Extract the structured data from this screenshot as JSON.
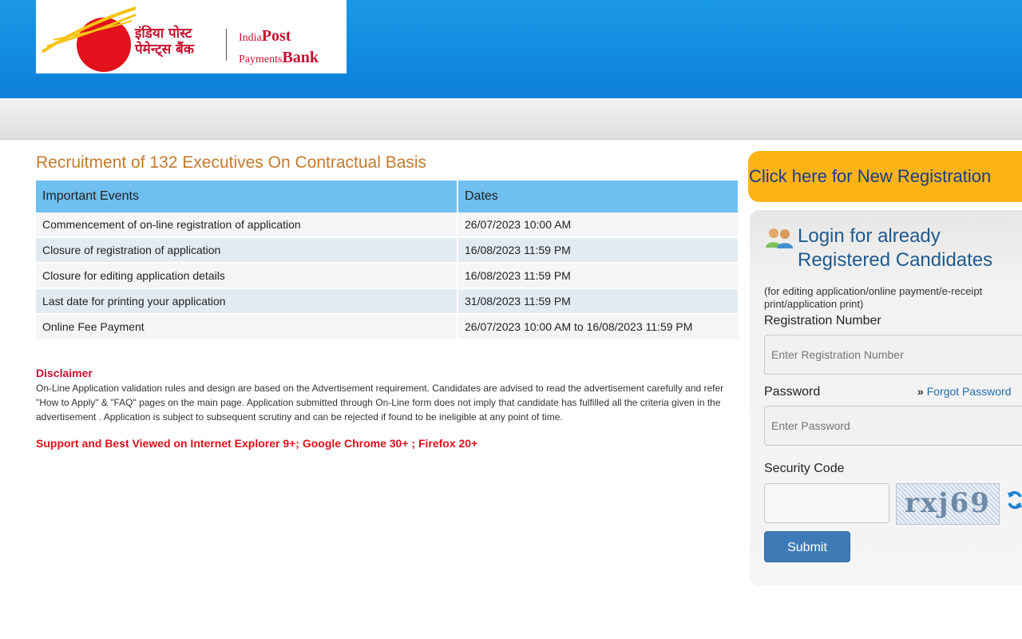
{
  "header": {
    "logo_hindi_line1": "इंडिया पोस्ट",
    "logo_hindi_line2": "पेमेन्ट्स बैंक",
    "logo_eng_small1": "India",
    "logo_eng_big1": "Post",
    "logo_eng_small2": "Payments",
    "logo_eng_big2": "Bank"
  },
  "main": {
    "title": "Recruitment of 132 Executives On Contractual Basis",
    "table": {
      "headers": [
        "Important Events",
        "Dates"
      ],
      "rows": [
        [
          "Commencement of on-line registration of application",
          "26/07/2023 10:00 AM"
        ],
        [
          "Closure of registration of application",
          "16/08/2023 11:59 PM"
        ],
        [
          "Closure for editing application details",
          "16/08/2023 11:59 PM"
        ],
        [
          "Last date for printing your application",
          "31/08/2023 11:59 PM"
        ],
        [
          "Online Fee Payment",
          "26/07/2023 10:00 AM to 16/08/2023 11:59 PM"
        ]
      ]
    },
    "disclaimer_title": "Disclaimer",
    "disclaimer_text": "On-Line Application validation rules and design are based on the Advertisement requirement. Candidates are advised to read the advertisement carefully and refer \"How to Apply\" & \"FAQ\" pages on the main page. Application submitted through On-Line form does not imply that candidate has fulfilled all the criteria given in the advertisement . Application is subject to subsequent scrutiny and can be rejected if found to be ineligible at any point of time.",
    "support_text": "Support and Best Viewed on Internet Explorer 9+; Google Chrome 30+ ; Firefox 20+"
  },
  "sidebar": {
    "new_registration": "Click here for New Registration",
    "login_title_line1": "Login for already",
    "login_title_line2": "Registered Candidates",
    "login_note": "(for editing application/online payment/e-receipt print/application print)",
    "reg_label": "Registration Number",
    "reg_placeholder": "Enter Registration Number",
    "password_label": "Password",
    "forgot_label": "Forgot Password",
    "password_placeholder": "Enter Password",
    "security_label": "Security Code",
    "captcha_text": "rxj69",
    "submit_label": "Submit"
  },
  "colors": {
    "top_bar": "#0d7fd9",
    "title": "#c57a2b",
    "table_header": "#6fbff0",
    "register_button": "#fcb415",
    "submit_button": "#3e7bb6",
    "disclaimer": "#c8102e"
  }
}
